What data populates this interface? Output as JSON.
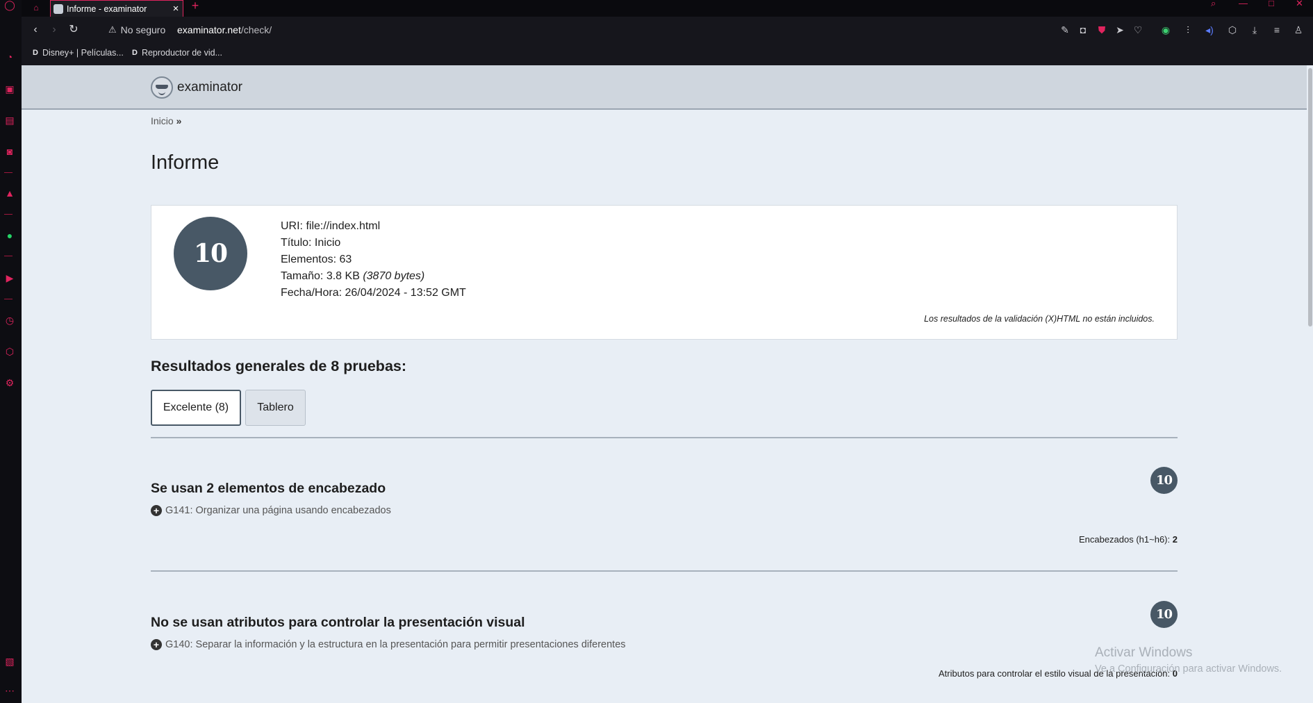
{
  "browser": {
    "tab": {
      "title": "Informe - examinator"
    },
    "security_label": "No seguro",
    "url_host": "examinator.net",
    "url_path": "/check/",
    "bookmarks": [
      {
        "label": "Disney+ | Películas...",
        "icon": "disney-icon"
      },
      {
        "label": "Reproductor de vid...",
        "icon": "disney-icon"
      }
    ],
    "colors": {
      "accent": "#e0245e",
      "chrome": "#16161c"
    }
  },
  "site": {
    "brand": "examinator",
    "breadcrumb": {
      "home": "Inicio",
      "sep": "»"
    }
  },
  "report": {
    "title": "Informe",
    "score": "10",
    "meta": {
      "uri_label": "URI:",
      "uri": "file://index.html",
      "title_label": "Título:",
      "title": "Inicio",
      "elements_label": "Elementos:",
      "elements": "63",
      "size_label": "Tamaño:",
      "size": "3.8 KB",
      "size_bytes": "(3870 bytes)",
      "date_label": "Fecha/Hora:",
      "date": "26/04/2024 - 13:52 GMT"
    },
    "note": "Los resultados de la validación (X)HTML no están incluidos."
  },
  "summary": {
    "heading": "Resultados generales de 8 pruebas:",
    "buttons": [
      {
        "label": "Excelente (8)"
      },
      {
        "label": "Tablero"
      }
    ]
  },
  "results": [
    {
      "title": "Se usan 2 elementos de encabezado",
      "score": "10",
      "technique": "G141: Organizar una página usando encabezados",
      "stat_label": "Encabezados (h1~h6):",
      "stat_value": "2"
    },
    {
      "title": "No se usan atributos para controlar la presentación visual",
      "score": "10",
      "technique": "G140: Separar la información y la estructura en la presentación para permitir presentaciones diferentes",
      "stat_label": "Atributos para controlar el estilo visual de la presentación:",
      "stat_value": "0"
    }
  ],
  "watermark": {
    "line1": "Activar Windows",
    "line2": "Ve a Configuración para activar Windows."
  }
}
